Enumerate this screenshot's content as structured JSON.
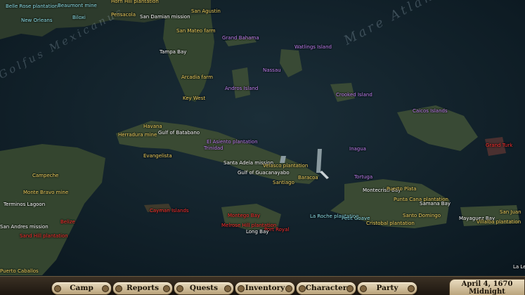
{
  "ocean_labels": {
    "gulf": "Golfus Mexicanus",
    "mare": "Mare Atlanticum"
  },
  "places": [
    {
      "text": "Belle Rose plantation",
      "color": "#8fe0e8"
    },
    {
      "text": "Beaumont mine",
      "color": "#8fe0e8"
    },
    {
      "text": "Horn Hill plantation",
      "color": "#f0d060"
    },
    {
      "text": "Pensacola",
      "color": "#f0d060"
    },
    {
      "text": "San Damian mission",
      "color": "#ffffff"
    },
    {
      "text": "San Agustin",
      "color": "#f0d060"
    },
    {
      "text": "New Orleans",
      "color": "#8fe0e8"
    },
    {
      "text": "Biloxi",
      "color": "#8fe0e8"
    },
    {
      "text": "San Mateo farm",
      "color": "#f0d060"
    },
    {
      "text": "Grand Bahama",
      "color": "#c080f0"
    },
    {
      "text": "Watlings Island",
      "color": "#c080f0"
    },
    {
      "text": "Tampa Bay",
      "color": "#ffffff"
    },
    {
      "text": "Nassau",
      "color": "#c080f0"
    },
    {
      "text": "Arcadia farm",
      "color": "#f0d060"
    },
    {
      "text": "Andros Island",
      "color": "#c080f0"
    },
    {
      "text": "Crooked Island",
      "color": "#c080f0"
    },
    {
      "text": "Key West",
      "color": "#f0d060"
    },
    {
      "text": "Caicos Islands",
      "color": "#c080f0"
    },
    {
      "text": "Havana",
      "color": "#f0d060"
    },
    {
      "text": "Gulf of Batabano",
      "color": "#ffffff"
    },
    {
      "text": "Herradura mine",
      "color": "#f0d060"
    },
    {
      "text": "El Asiento plantation",
      "color": "#c080f0"
    },
    {
      "text": "Trinidad",
      "color": "#c080f0"
    },
    {
      "text": "Grand Turk",
      "color": "#ff3030"
    },
    {
      "text": "Inagua",
      "color": "#c080f0"
    },
    {
      "text": "Evangelista",
      "color": "#f0d060"
    },
    {
      "text": "Santa Adela mission",
      "color": "#ffffff"
    },
    {
      "text": "Velasco plantation",
      "color": "#f0d060"
    },
    {
      "text": "Gulf of Guacanayabo",
      "color": "#ffffff"
    },
    {
      "text": "Baracoa",
      "color": "#f0d060"
    },
    {
      "text": "Tortuga",
      "color": "#c080f0"
    },
    {
      "text": "Campeche",
      "color": "#f0d060"
    },
    {
      "text": "Santiago",
      "color": "#f0d060"
    },
    {
      "text": "Montecristi Bay",
      "color": "#ffffff"
    },
    {
      "text": "Puerto Plata",
      "color": "#f0d060"
    },
    {
      "text": "Monte Bravo mine",
      "color": "#f0d060"
    },
    {
      "text": "Punta Cana plantation",
      "color": "#f0d060"
    },
    {
      "text": "Terminos Lagoon",
      "color": "#ffffff"
    },
    {
      "text": "Samana Bay",
      "color": "#ffffff"
    },
    {
      "text": "Cayman Islands",
      "color": "#ff3030"
    },
    {
      "text": "San Juan",
      "color": "#f0d060"
    },
    {
      "text": "Montego Bay",
      "color": "#ff3030"
    },
    {
      "text": "La Roche plantation",
      "color": "#8fe0e8"
    },
    {
      "text": "Petit Goave",
      "color": "#8fe0e8"
    },
    {
      "text": "Santo Domingo",
      "color": "#f0d060"
    },
    {
      "text": "Mayaguez Bay",
      "color": "#ffffff"
    },
    {
      "text": "Villalba plantation",
      "color": "#f0d060"
    },
    {
      "text": "Belize",
      "color": "#ff3030"
    },
    {
      "text": "Melrose Hill plantation",
      "color": "#ff3030"
    },
    {
      "text": "Port Royal",
      "color": "#ff3030"
    },
    {
      "text": "Cristobal plantation",
      "color": "#f0d060"
    },
    {
      "text": "San Andres mission",
      "color": "#ffffff"
    },
    {
      "text": "Long Bay",
      "color": "#ffffff"
    },
    {
      "text": "Sand Hill plantation",
      "color": "#ff3030"
    },
    {
      "text": "Puerto Caballos",
      "color": "#f0d060"
    },
    {
      "text": "La Le",
      "color": "#ffffff"
    }
  ],
  "menu": {
    "camp": "Camp",
    "reports": "Reports",
    "quests": "Quests",
    "inventory": "Inventory",
    "character": "Character",
    "party": "Party"
  },
  "clock": {
    "date": "April 4, 1670",
    "time": "Midnight"
  }
}
